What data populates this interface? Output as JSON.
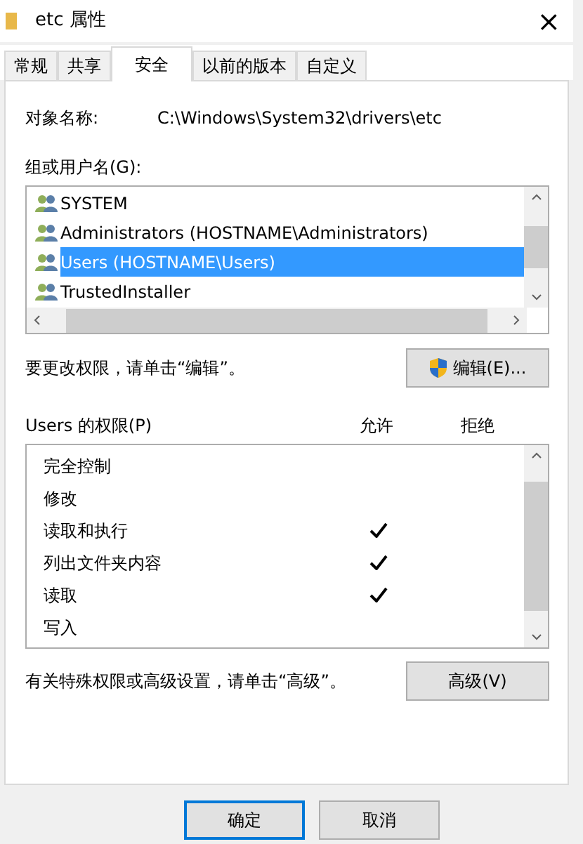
{
  "window": {
    "title": "etc 属性",
    "close": "×"
  },
  "tabs": [
    {
      "label": "常规",
      "selected": false
    },
    {
      "label": "共享",
      "selected": false
    },
    {
      "label": "安全",
      "selected": true
    },
    {
      "label": "以前的版本",
      "selected": false
    },
    {
      "label": "自定义",
      "selected": false
    }
  ],
  "object_name": {
    "label": "对象名称:",
    "value": "C:\\Windows\\System32\\drivers\\etc"
  },
  "groups": {
    "label": "组或用户名(G):",
    "items": [
      {
        "name": "SYSTEM",
        "selected": false
      },
      {
        "name": "Administrators (HOSTNAME\\Administrators)",
        "selected": false
      },
      {
        "name": "Users (HOSTNAME\\Users)",
        "selected": true
      },
      {
        "name": "TrustedInstaller",
        "selected": false
      }
    ]
  },
  "edit_hint": "要更改权限，请单击“编辑”。",
  "edit_button": "编辑(E)...",
  "permissions": {
    "label": "Users 的权限(P)",
    "allow_header": "允许",
    "deny_header": "拒绝",
    "rows": [
      {
        "name": "完全控制",
        "allow": false,
        "deny": false
      },
      {
        "name": "修改",
        "allow": false,
        "deny": false
      },
      {
        "name": "读取和执行",
        "allow": true,
        "deny": false
      },
      {
        "name": "列出文件夹内容",
        "allow": true,
        "deny": false
      },
      {
        "name": "读取",
        "allow": true,
        "deny": false
      },
      {
        "name": "写入",
        "allow": false,
        "deny": false
      }
    ]
  },
  "advanced_hint": "有关特殊权限或高级设置，请单击“高级”。",
  "advanced_button": "高级(V)",
  "buttons": [
    {
      "label": "确定",
      "default": true
    },
    {
      "label": "取消",
      "default": false
    }
  ]
}
